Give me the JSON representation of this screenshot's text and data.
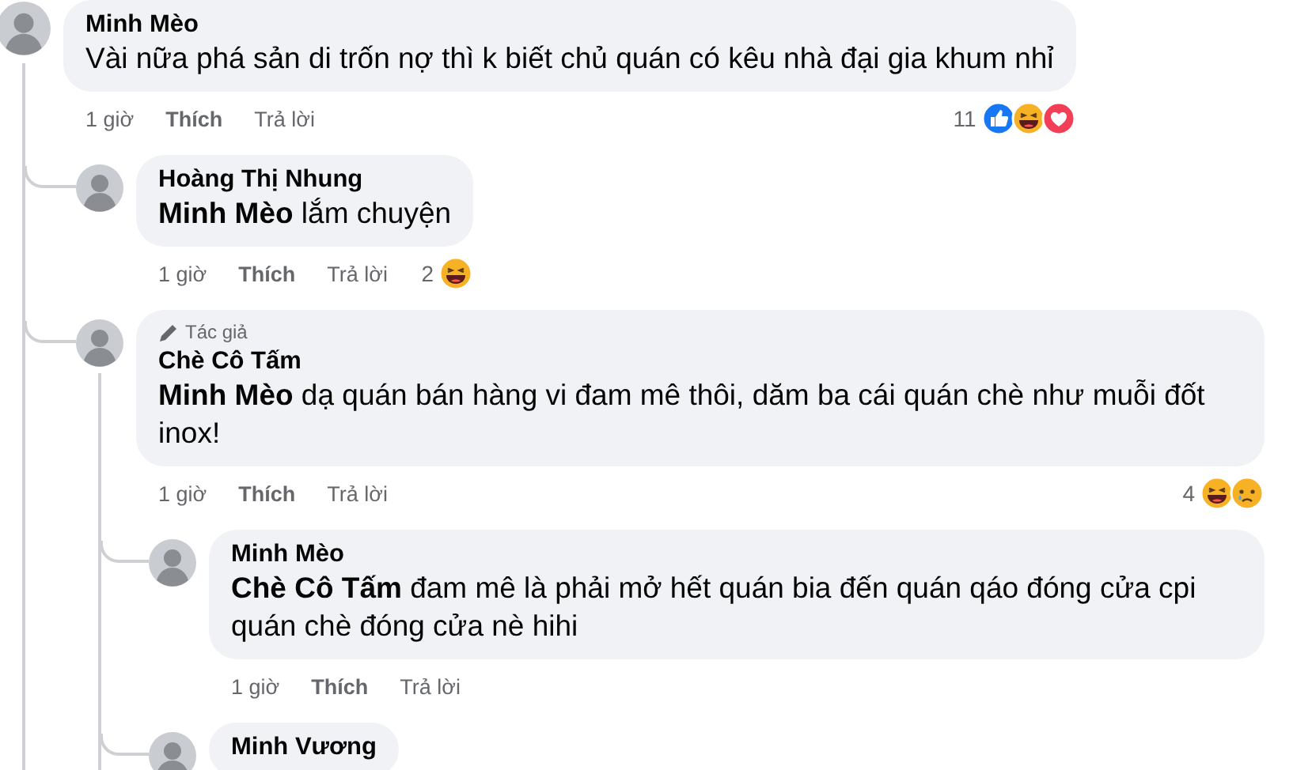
{
  "comments": [
    {
      "name": "Minh Mèo",
      "text": "Vài nữa phá sản di trốn nợ thì k biết chủ quán có kêu nhà đại gia khum nhỉ",
      "time": "1 giờ",
      "like": "Thích",
      "reply": "Trả lời",
      "reactions": {
        "count": "11",
        "types": [
          {
            "kind": "like"
          },
          {
            "kind": "haha"
          },
          {
            "kind": "love"
          }
        ]
      },
      "children": [
        {
          "name": "Hoàng Thị Nhung",
          "text": "**Minh Mèo** lắm chuyện",
          "time": "1 giờ",
          "like": "Thích",
          "reply": "Trả lời",
          "reactions": {
            "count": "2",
            "types": [
              {
                "kind": "haha"
              }
            ]
          }
        },
        {
          "name": "Chè Cô Tấm",
          "author_badge": "Tác giả",
          "text": "**Minh Mèo** dạ quán bán hàng vi đam mê thôi, dăm ba cái quán chè như muỗi đốt inox!",
          "time": "1 giờ",
          "like": "Thích",
          "reply": "Trả lời",
          "reactions": {
            "count": "4",
            "types": [
              {
                "kind": "haha"
              },
              {
                "kind": "sad"
              }
            ]
          },
          "children": [
            {
              "name": "Minh Mèo",
              "text": "**Chè Cô Tấm** đam mê là phải mở hết quán bia đến quán qáo đóng cửa cpi quán chè đóng cửa nè hihi",
              "time": "1 giờ",
              "like": "Thích",
              "reply": "Trả lời"
            },
            {
              "name": "Minh Vương"
            }
          ]
        }
      ]
    }
  ]
}
